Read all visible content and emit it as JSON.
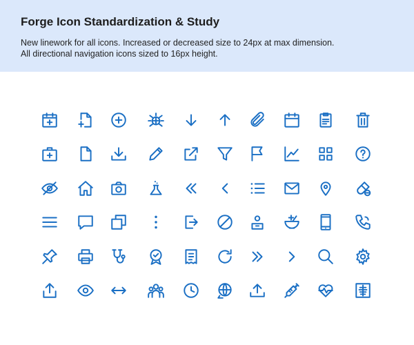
{
  "header": {
    "title": "Forge Icon Standardization & Study",
    "line1": "New linework for all icons. Increased or decreased size to 24px at max dimension.",
    "line2": "All directional navigation icons sized to 16px height."
  },
  "icons": [
    [
      "calendar-add-icon",
      "file-add-icon",
      "plus-circle-icon",
      "bug-icon",
      "arrow-down-icon",
      "arrow-up-icon",
      "paperclip-icon",
      "calendar-icon",
      "clipboard-icon",
      "trash-icon"
    ],
    [
      "medical-kit-icon",
      "file-icon",
      "download-tray-icon",
      "pencil-icon",
      "external-link-icon",
      "filter-icon",
      "flag-icon",
      "line-chart-icon",
      "grid-icon",
      "help-circle-icon"
    ],
    [
      "eye-off-icon",
      "home-icon",
      "camera-icon",
      "flask-icon",
      "chevrons-left-icon",
      "chevron-left-icon",
      "list-icon",
      "mail-icon",
      "location-pin-icon",
      "pill-icon"
    ],
    [
      "menu-icon",
      "chat-bubble-icon",
      "copy-icon",
      "more-vertical-icon",
      "sign-out-icon",
      "block-icon",
      "user-badge-icon",
      "mortar-pestle-icon",
      "mobile-phone-icon",
      "phone-icon"
    ],
    [
      "pin-icon",
      "printer-icon",
      "stethoscope-icon",
      "award-icon",
      "receipt-icon",
      "refresh-icon",
      "chevrons-right-icon",
      "chevron-right-icon",
      "search-icon",
      "settings-gear-icon"
    ],
    [
      "share-upload-icon",
      "eye-icon",
      "arrows-left-right-icon",
      "team-icon",
      "clock-icon",
      "global-chat-icon",
      "upload-tray-icon",
      "syringe-icon",
      "heart-pulse-icon",
      "xray-icon"
    ]
  ]
}
